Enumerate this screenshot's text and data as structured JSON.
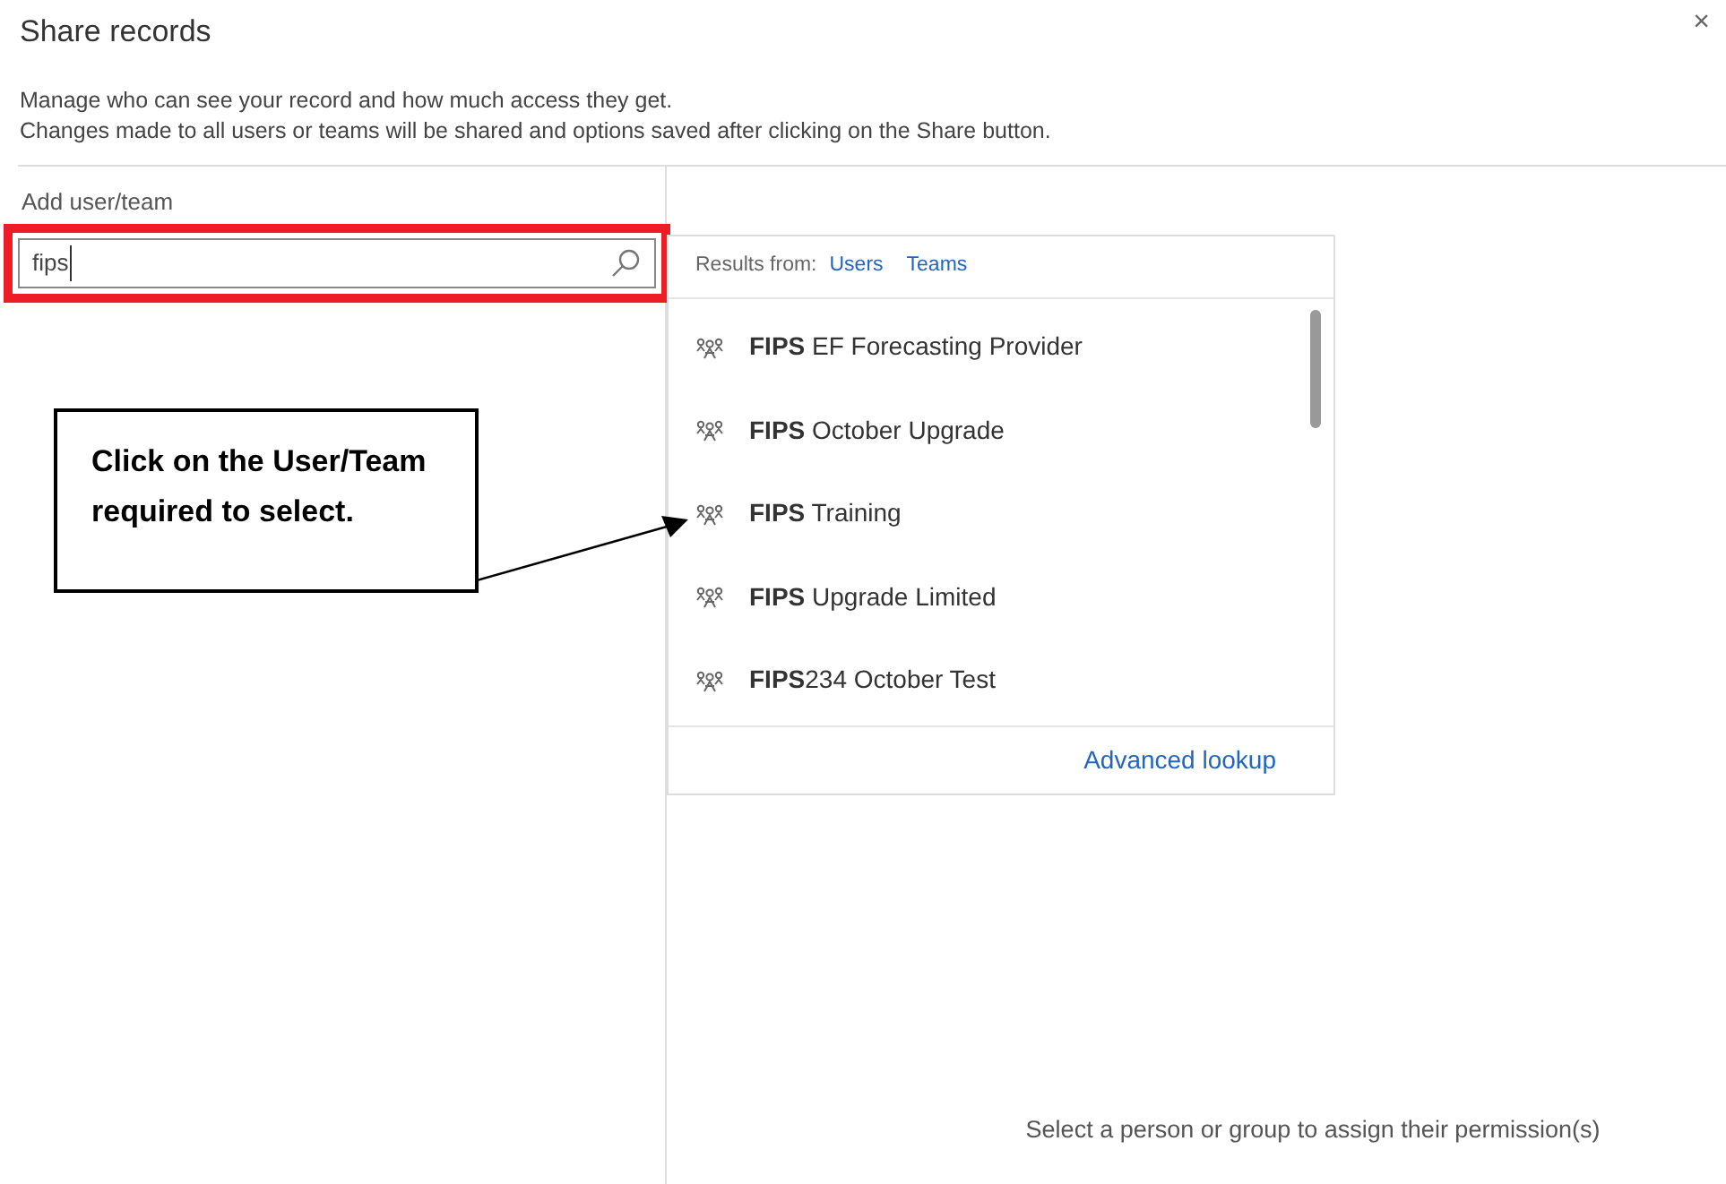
{
  "dialog": {
    "title": "Share records",
    "close": "×",
    "description": [
      "Manage who can see your record and how much access they get.",
      "Changes made to all users or teams will be shared and options saved after clicking on the Share button."
    ]
  },
  "add_user": {
    "label": "Add user/team",
    "value": "fips"
  },
  "results": {
    "label": "Results from:",
    "filters": [
      {
        "label": "Users"
      },
      {
        "label": "Teams"
      }
    ],
    "items": [
      {
        "name": "**FIPS** EF Forecasting Provider"
      },
      {
        "name": "**FIPS** October Upgrade"
      },
      {
        "name": "**FIPS** Training"
      },
      {
        "name": "**FIPS** Upgrade Limited"
      },
      {
        "name": "**FIPS**234 October Test"
      }
    ],
    "advanced_lookup": "Advanced lookup"
  },
  "callout": {
    "text": "Click on the User/Team required to select."
  },
  "permissions_hint": "Select a person or group to assign their permission(s)"
}
